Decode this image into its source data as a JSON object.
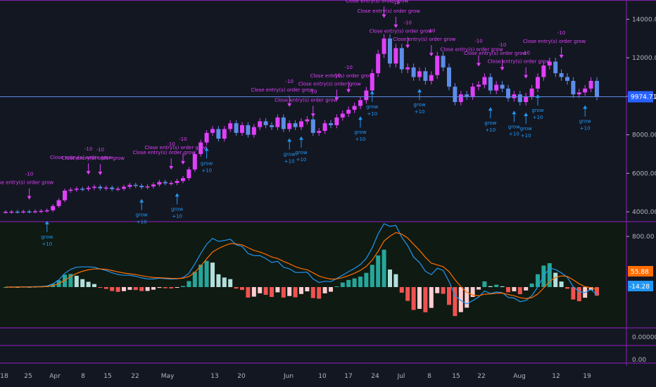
{
  "chart_data": [
    {
      "type": "candlestick",
      "title": "",
      "y_axis_labels": [
        "14000.00",
        "12000.00",
        "10000.00",
        "8000.00",
        "6000.00",
        "4000.00"
      ],
      "ylim": [
        3600,
        15000
      ],
      "last_price_label": "9974.71",
      "last_price": 9974.71,
      "x_labels": [
        "18",
        "25",
        "Apr",
        "8",
        "15",
        "22",
        "May",
        "13",
        "20",
        "Jun",
        "10",
        "17",
        "24",
        "Jul",
        "8",
        "15",
        "22",
        "Aug",
        "12",
        "19"
      ],
      "close_series": [
        4000,
        4010,
        4005,
        4020,
        4015,
        4030,
        4050,
        4080,
        4300,
        4600,
        5100,
        5150,
        5200,
        5180,
        5250,
        5300,
        5220,
        5260,
        5180,
        5200,
        5300,
        5400,
        5350,
        5280,
        5320,
        5420,
        5550,
        5480,
        5500,
        5600,
        5750,
        6200,
        7000,
        7600,
        8100,
        8300,
        7800,
        8300,
        8600,
        8100,
        8500,
        8000,
        8400,
        8700,
        8500,
        8400,
        8900,
        8300,
        8600,
        8400,
        8700,
        8800,
        8100,
        8200,
        8600,
        8500,
        8900,
        9100,
        9300,
        9500,
        9800,
        10300,
        11200,
        12200,
        13000,
        11700,
        12500,
        11400,
        11500,
        11000,
        11300,
        10800,
        11100,
        12100,
        11500,
        10500,
        9700,
        10100,
        10000,
        10500,
        10600,
        11000,
        10300,
        10600,
        10400,
        9900,
        10100,
        9700,
        10000,
        10400,
        11000,
        11600,
        11800,
        11200,
        11000,
        10800,
        10100,
        10200,
        10400,
        10800,
        9975
      ],
      "annotations": {
        "sell_label": "Close entry(s) order grow",
        "sell_qty": "-10",
        "buy_label": "grow",
        "buy_qty": "+10"
      }
    },
    {
      "type": "macd",
      "y_axis_labels": [
        "800.00"
      ],
      "macd_value_label": "55.88",
      "signal_value_label": "-14.28",
      "colors": {
        "macd": "#2196f3",
        "signal": "#ff6d00",
        "hist_up_strong": "#26a69a",
        "hist_up_weak": "#b2dfdb",
        "hist_down_strong": "#ef5350",
        "hist_down_weak": "#ffcdd2"
      }
    },
    {
      "type": "line",
      "y_axis_labels": [
        "0.000000"
      ]
    },
    {
      "type": "line",
      "y_axis_labels": [
        "0.00"
      ]
    }
  ]
}
